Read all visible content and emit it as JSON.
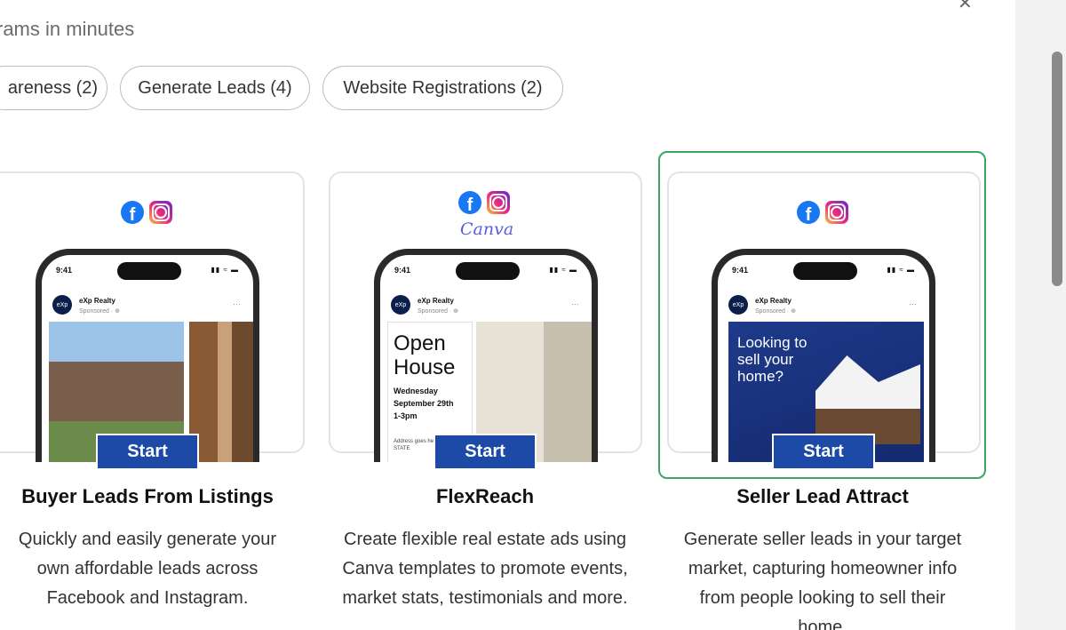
{
  "header": {
    "subtitle": "rams in minutes",
    "close_icon": "close-icon"
  },
  "filters": [
    {
      "label": "areness (2)"
    },
    {
      "label": "Generate Leads (4)"
    },
    {
      "label": "Website Registrations (2)"
    }
  ],
  "cards": [
    {
      "title": "Buyer Leads From Listings",
      "description": "Quickly and easily generate your own affordable leads across Facebook and Instagram.",
      "button": "Start",
      "phone": {
        "time": "9:41",
        "brand": "eXp Realty",
        "sponsored": "Sponsored · ⊕",
        "avatar": "eXp"
      }
    },
    {
      "title": "FlexReach",
      "description": "Create flexible real estate ads using Canva templates to promote events, market stats, testimonials and more.",
      "button": "Start",
      "canva_logo": "Canva",
      "phone": {
        "time": "9:41",
        "brand": "eXp Realty",
        "sponsored": "Sponsored · ⊕",
        "avatar": "eXp"
      },
      "ad": {
        "headline": "Open House",
        "day": "Wednesday",
        "date": "September 29th",
        "time": "1-3pm",
        "address": "Address goes here City STATE"
      }
    },
    {
      "title": "Seller Lead Attract",
      "description": "Generate seller leads in your target market, capturing homeowner info from people looking to sell their home.",
      "button": "Start",
      "selected": true,
      "phone": {
        "time": "9:41",
        "brand": "eXp Realty",
        "sponsored": "Sponsored · ⊕",
        "avatar": "eXp"
      },
      "ad": {
        "headline": "Looking to sell your home?"
      }
    }
  ],
  "colors": {
    "accent_button": "#1c4aa6",
    "selected_border": "#3aa564",
    "facebook": "#1877f2"
  }
}
